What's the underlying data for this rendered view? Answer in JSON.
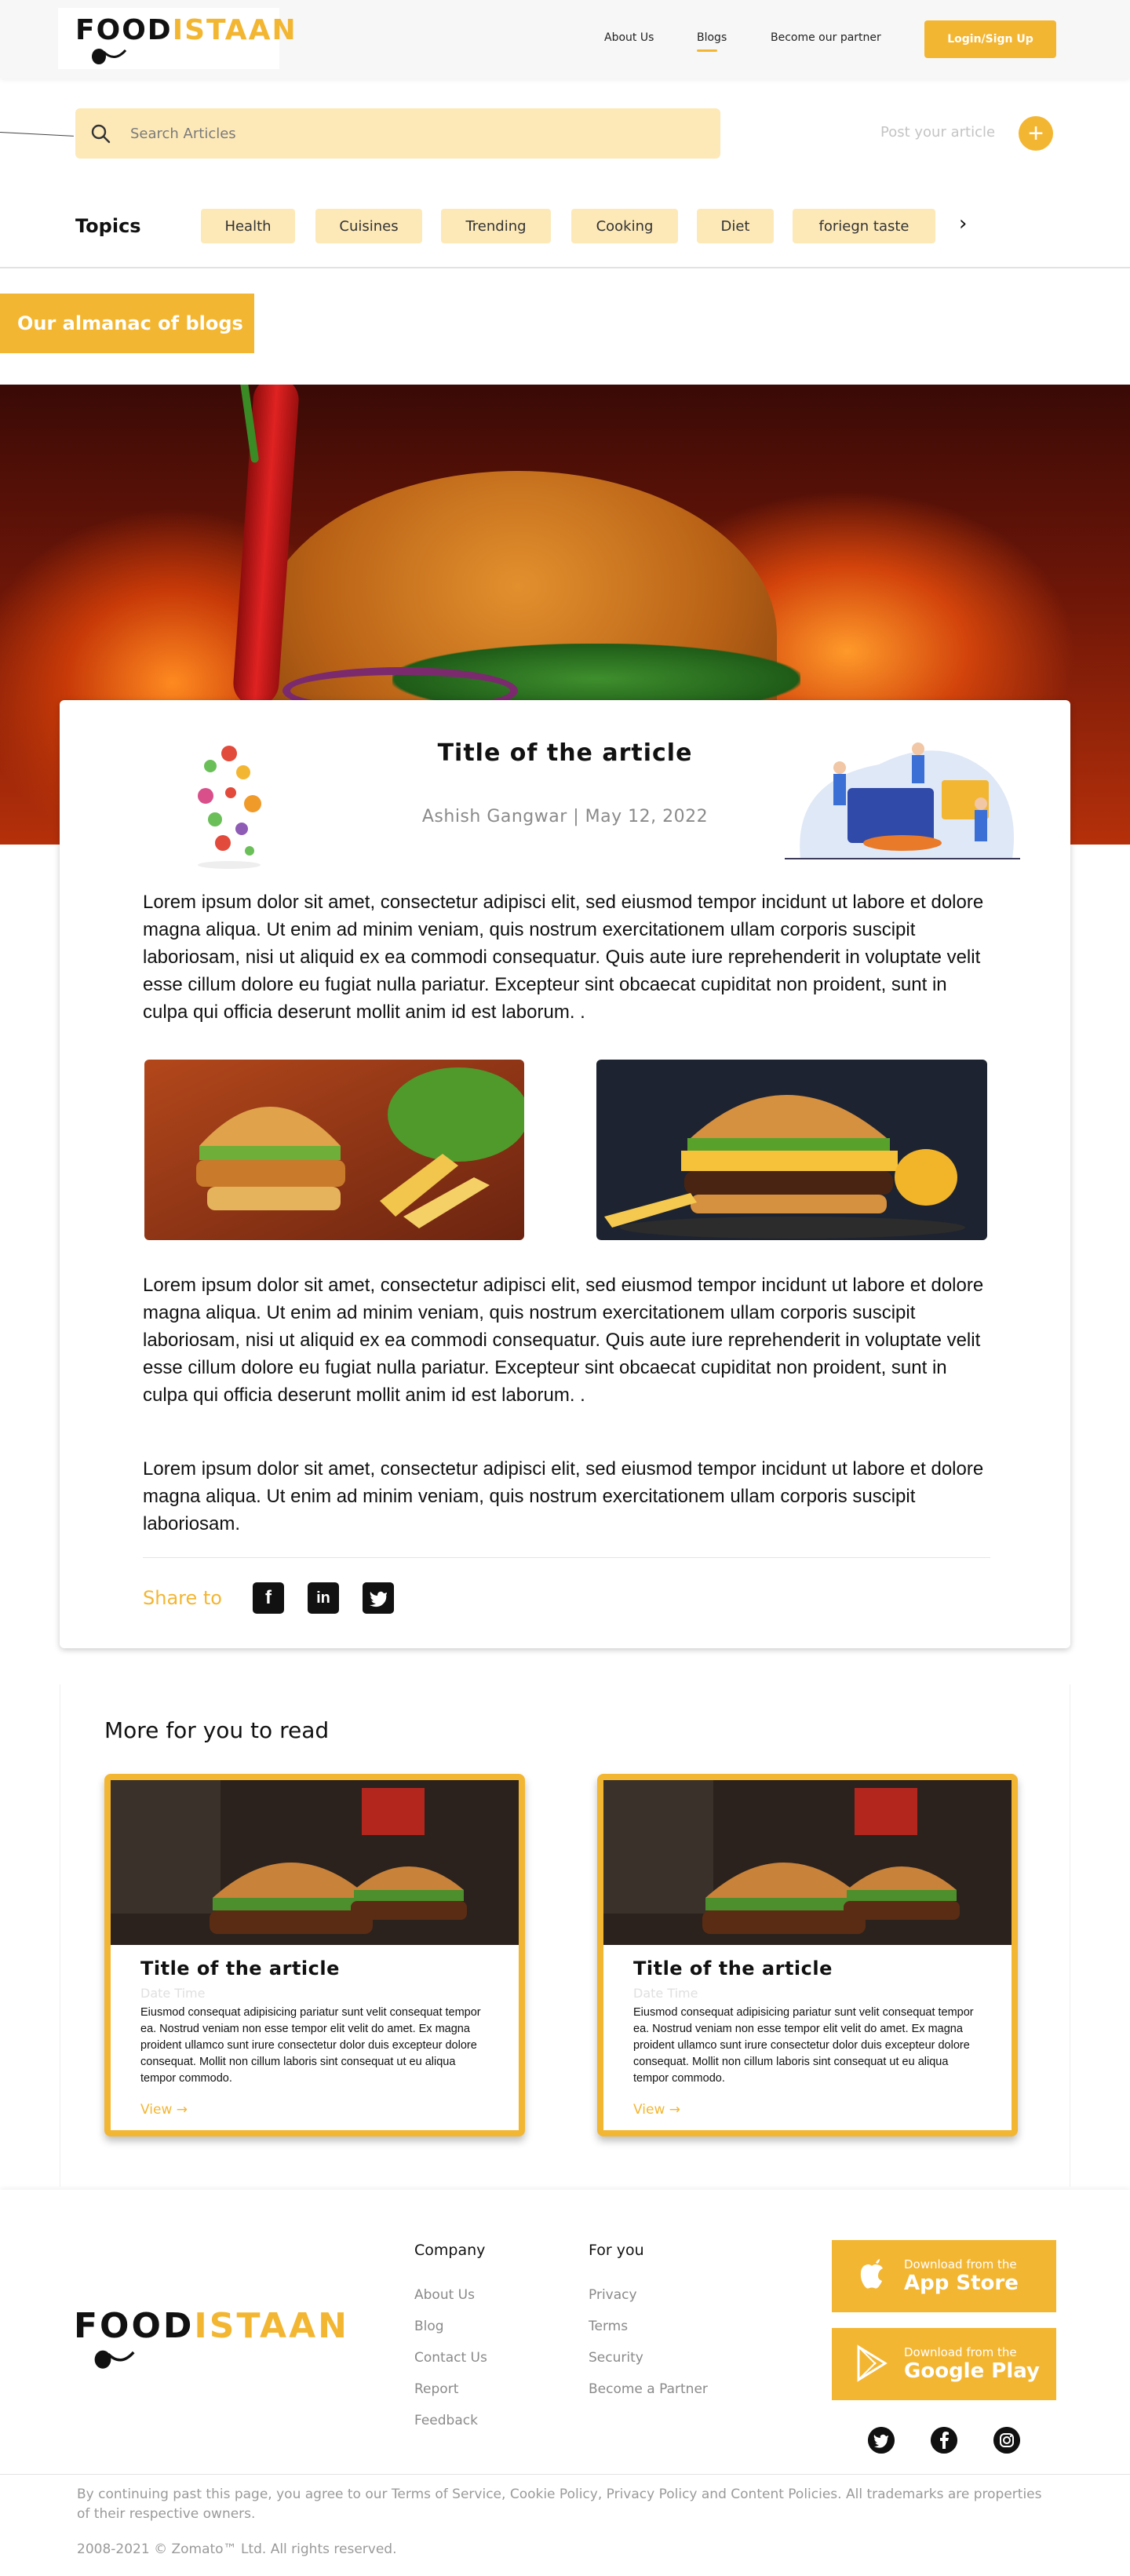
{
  "header": {
    "logo": {
      "part1": "FOOD",
      "part2": "ISTAAN"
    },
    "nav": [
      "About Us",
      "Blogs",
      "Become our partner"
    ],
    "active_nav": "Blogs",
    "login_label": "Login/Sign Up"
  },
  "search": {
    "placeholder": "Search Articles",
    "post_label": "Post your article"
  },
  "topics": {
    "label": "Topics",
    "chips": [
      "Health",
      "Cuisines",
      "Trending",
      "Cooking",
      "Diet",
      "foriegn taste"
    ],
    "next_glyph": "›"
  },
  "almanac_label": "Our almanac of blogs",
  "article": {
    "title": "Title of the article",
    "meta": "Ashish Gangwar | May 12, 2022",
    "paragraphs": [
      "Lorem ipsum dolor sit amet, consectetur adipisci elit, sed eiusmod tempor incidunt ut labore et dolore magna aliqua. Ut enim ad minim veniam, quis nostrum exercitationem ullam corporis suscipit laboriosam, nisi ut aliquid ex ea commodi consequatur. Quis aute iure reprehenderit in voluptate velit esse cillum dolore eu fugiat nulla pariatur. Excepteur sint obcaecat cupiditat non proident, sunt in culpa qui officia deserunt mollit anim id est laborum. .",
      "Lorem ipsum dolor sit amet, consectetur adipisci elit, sed eiusmod tempor incidunt ut labore et dolore magna aliqua. Ut enim ad minim veniam, quis nostrum exercitationem ullam corporis suscipit laboriosam, nisi ut aliquid ex ea commodi consequatur. Quis aute iure reprehenderit in voluptate velit esse cillum dolore eu fugiat nulla pariatur. Excepteur sint obcaecat cupiditat non proident, sunt in culpa qui officia deserunt mollit anim id est laborum. .",
      "Lorem ipsum dolor sit amet, consectetur adipisci elit, sed eiusmod tempor incidunt ut labore et dolore magna aliqua. Ut enim ad minim veniam, quis nostrum exercitationem ullam corporis suscipit laboriosam."
    ],
    "share_label": "Share to",
    "share_icons": [
      "facebook-icon",
      "linkedin-icon",
      "twitter-icon"
    ]
  },
  "more": {
    "title": "More for you to read",
    "cards": [
      {
        "title": "Title of the article",
        "date": "Date  Time",
        "text": "Eiusmod consequat adipisicing pariatur sunt velit consequat tempor ea. Nostrud veniam non esse tempor elit velit do amet. Ex magna proident ullamco sunt irure consectetur dolor duis excepteur dolore consequat. Mollit non cillum laboris sint consequat ut eu aliqua tempor commodo.",
        "view": "View"
      },
      {
        "title": "Title of the article",
        "date": "Date  Time",
        "text": "Eiusmod consequat adipisicing pariatur sunt velit consequat tempor ea. Nostrud veniam non esse tempor elit velit do amet. Ex magna proident ullamco sunt irure consectetur dolor duis excepteur dolore consequat. Mollit non cillum laboris sint consequat ut eu aliqua tempor commodo.",
        "view": "View"
      }
    ]
  },
  "footer": {
    "logo": {
      "part1": "FOOD",
      "part2": "ISTAAN"
    },
    "company": {
      "title": "Company",
      "links": [
        "About Us",
        "Blog",
        "Contact Us",
        "Report",
        "Feedback"
      ]
    },
    "for_you": {
      "title": "For you",
      "links": [
        "Privacy",
        "Terms",
        "Security",
        "Become a Partner"
      ]
    },
    "app_store": {
      "small": "Download from the",
      "big": "App Store"
    },
    "google_play": {
      "small": "Download from the",
      "big": "Google Play"
    },
    "social_icons": [
      "twitter-icon",
      "facebook-icon",
      "instagram-icon"
    ],
    "legal": "By continuing past this page, you agree to our Terms of Service, Cookie Policy, Privacy Policy and Content Policies. All trademarks are properties of their respective owners.",
    "copyright": "2008-2021 © Zomato™ Ltd. All rights reserved."
  },
  "colors": {
    "accent": "#f3b632",
    "accent_light": "#fde9b8",
    "muted": "#8a8a8a"
  }
}
